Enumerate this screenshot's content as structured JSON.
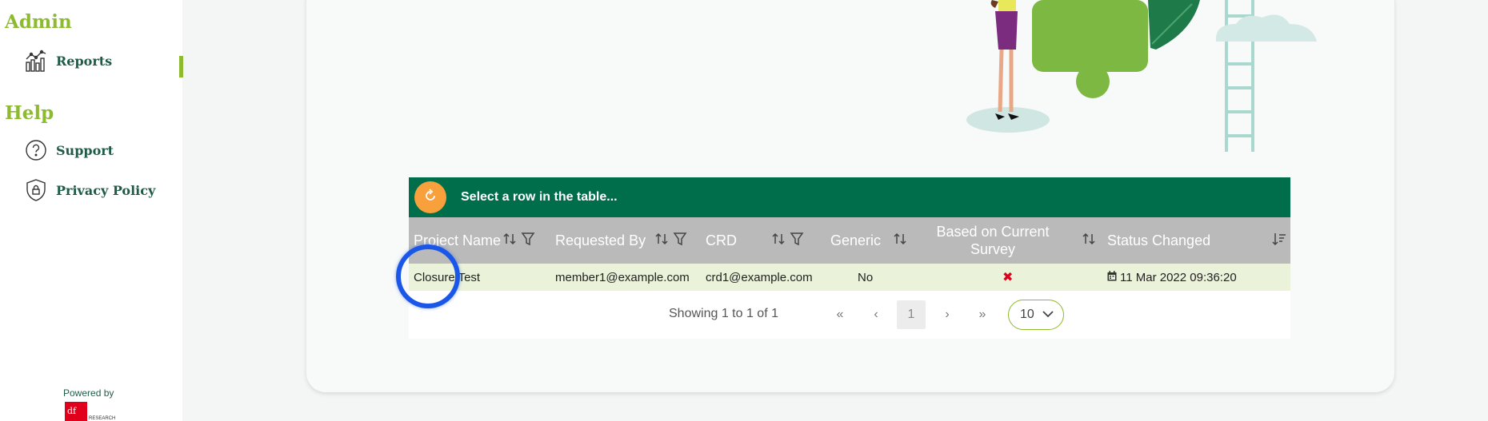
{
  "sidebar": {
    "admin_title": "Admin",
    "help_title": "Help",
    "items": [
      {
        "label": "Reports",
        "icon": "reports-chart-icon"
      },
      {
        "label": "Support",
        "icon": "question-circle-icon"
      },
      {
        "label": "Privacy Policy",
        "icon": "shield-lock-icon"
      }
    ],
    "powered_by": "Powered by",
    "brand_mark": "df",
    "brand_sub": "RESEARCH"
  },
  "table": {
    "header_message": "Select a row in the table...",
    "columns": [
      {
        "label": "Project Name",
        "sortable": true,
        "filterable": true
      },
      {
        "label": "Requested By",
        "sortable": true,
        "filterable": true
      },
      {
        "label": "CRD",
        "sortable": true,
        "filterable": true
      },
      {
        "label": "Generic",
        "sortable": true,
        "filterable": false
      },
      {
        "label": "Based on Current Survey",
        "sortable": true,
        "filterable": false
      },
      {
        "label": "Status Changed",
        "sortable": true,
        "filterable": false
      }
    ],
    "rows": [
      {
        "project_name": "Closure Test",
        "requested_by": "member1@example.com",
        "crd": "crd1@example.com",
        "generic": "No",
        "based_on_current_survey": "✖",
        "status_changed": "11 Mar 2022 09:36:20"
      }
    ],
    "pagination": {
      "summary": "Showing 1 to 1 of 1",
      "first": "«",
      "prev": "‹",
      "current_page": "1",
      "next": "›",
      "last": "»",
      "page_size": "10"
    }
  },
  "colors": {
    "accent_green": "#8dba2e",
    "header_green": "#006e4a",
    "refresh_orange": "#f7a03c",
    "row_highlight": "#eaf2da",
    "false_red": "#e0001b"
  }
}
